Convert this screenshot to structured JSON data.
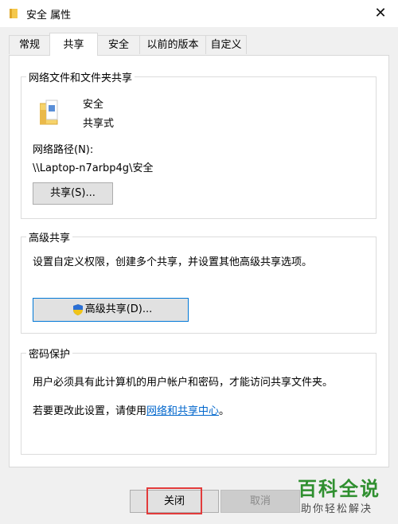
{
  "window": {
    "title": "安全 属性",
    "close_glyph": "✕"
  },
  "tabs": [
    {
      "label": "常规",
      "active": false
    },
    {
      "label": "共享",
      "active": true
    },
    {
      "label": "安全",
      "active": false
    },
    {
      "label": "以前的版本",
      "active": false
    },
    {
      "label": "自定义",
      "active": false
    }
  ],
  "network_sharing": {
    "title": "网络文件和文件夹共享",
    "folder_name": "安全",
    "share_state": "共享式",
    "path_label": "网络路径(N):",
    "path_value": "\\\\Laptop-n7arbp4g\\安全",
    "share_button": "共享(S)..."
  },
  "advanced_sharing": {
    "title": "高级共享",
    "description": "设置自定义权限，创建多个共享，并设置其他高级共享选项。",
    "button": "高级共享(D)..."
  },
  "password_protection": {
    "title": "密码保护",
    "description": "用户必须具有此计算机的用户帐户和密码，才能访问共享文件夹。",
    "change_prefix": "若要更改此设置，请使用",
    "link_text": "网络和共享中心",
    "change_suffix": "。"
  },
  "footer": {
    "close_button": "关闭",
    "cancel_button": "取消"
  },
  "watermark": {
    "main": "百科全说",
    "sub": "助你轻松解决"
  },
  "colors": {
    "link": "#0066cc",
    "highlight": "#e23b3b",
    "accent_border": "#0078d7",
    "watermark": "#2f8f2f"
  }
}
